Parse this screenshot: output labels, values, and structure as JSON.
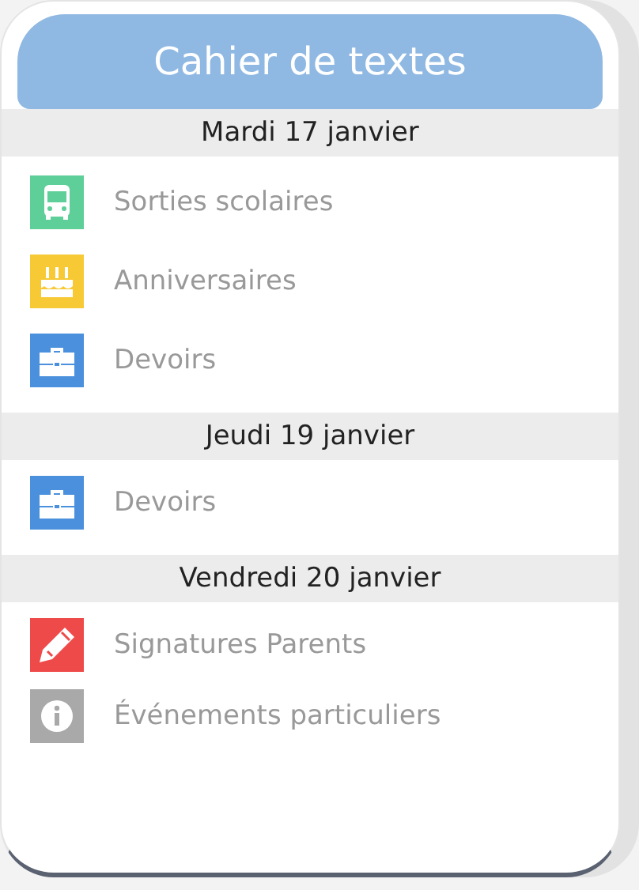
{
  "title": "Cahier de textes",
  "days": [
    {
      "date": "Mardi 17 janvier",
      "items": [
        {
          "label": "Sorties scolaires",
          "kind": "bus",
          "color": "#5ecf99"
        },
        {
          "label": "Anniversaires",
          "kind": "cake",
          "color": "#f6c935"
        },
        {
          "label": "Devoirs",
          "kind": "briefcase",
          "color": "#4a90dd"
        }
      ]
    },
    {
      "date": "Jeudi 19 janvier",
      "items": [
        {
          "label": "Devoirs",
          "kind": "briefcase",
          "color": "#4a90dd"
        }
      ]
    },
    {
      "date": "Vendredi 20 janvier",
      "items": [
        {
          "label": "Signatures Parents",
          "kind": "pencil",
          "color": "#ee4a4a"
        },
        {
          "label": "Événements particuliers",
          "kind": "info",
          "color": "#a9a9a9"
        }
      ]
    }
  ]
}
